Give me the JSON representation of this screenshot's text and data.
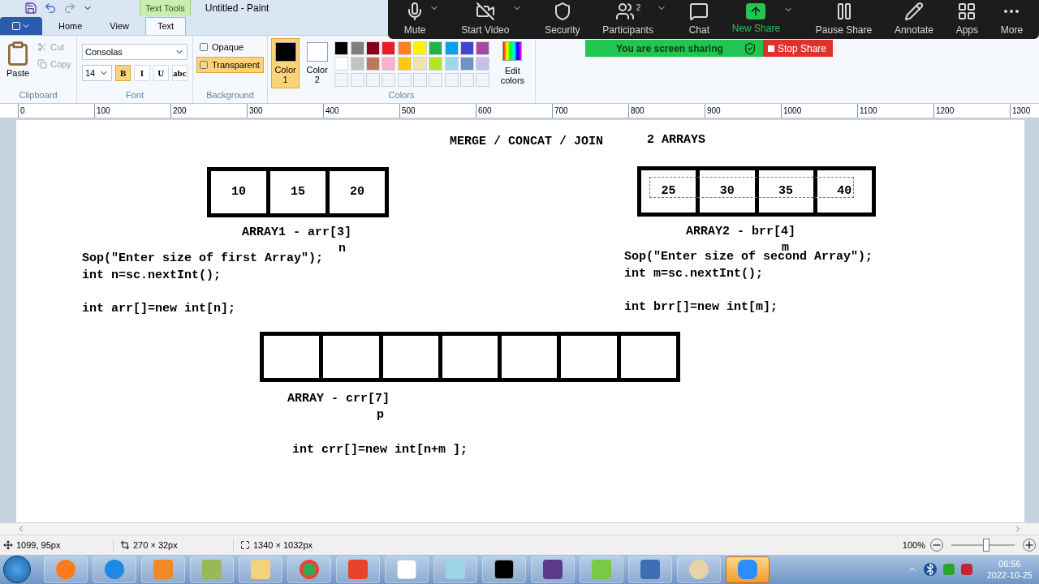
{
  "window": {
    "title": "Untitled - Paint",
    "contextual_tab": "Text Tools"
  },
  "ribbon_tabs": [
    {
      "label": "Home",
      "selected": false
    },
    {
      "label": "View",
      "selected": false
    },
    {
      "label": "Text",
      "selected": true
    }
  ],
  "clipboard": {
    "paste": "Paste",
    "cut": "Cut",
    "copy": "Copy",
    "group": "Clipboard"
  },
  "font": {
    "family": "Consolas",
    "size": "14",
    "group": "Font",
    "styles": [
      {
        "label": "B",
        "selected": true
      },
      {
        "label": "I",
        "selected": false
      },
      {
        "label": "U",
        "selected": false
      },
      {
        "label": "abc",
        "selected": false
      }
    ]
  },
  "background": {
    "group": "Background",
    "options": [
      {
        "label": "Opaque",
        "selected": false
      },
      {
        "label": "Transparent",
        "selected": true
      }
    ]
  },
  "colors": {
    "group": "Colors",
    "edit": "Edit colors",
    "slots": [
      {
        "label": "Color",
        "number": "1",
        "color": "#000000",
        "selected": true
      },
      {
        "label": "Color",
        "number": "2",
        "color": "#ffffff",
        "selected": false
      }
    ],
    "palette": [
      {
        "color": "#000000"
      },
      {
        "color": "#7f7f7f"
      },
      {
        "color": "#880015"
      },
      {
        "color": "#ed1c24"
      },
      {
        "color": "#ff7f27"
      },
      {
        "color": "#fff200"
      },
      {
        "color": "#22b14c"
      },
      {
        "color": "#00a2e8"
      },
      {
        "color": "#3f48cc"
      },
      {
        "color": "#a349a4"
      },
      {
        "color": "#ffffff"
      },
      {
        "color": "#c3c3c3"
      },
      {
        "color": "#b97a57"
      },
      {
        "color": "#ffaec9"
      },
      {
        "color": "#ffc90e"
      },
      {
        "color": "#efe4b0"
      },
      {
        "color": "#b5e61d"
      },
      {
        "color": "#99d9ea"
      },
      {
        "color": "#7092be"
      },
      {
        "color": "#c8bfe7"
      }
    ]
  },
  "ruler": [
    "0",
    "100",
    "200",
    "300",
    "400",
    "500",
    "600",
    "700",
    "800",
    "900",
    "1000",
    "1100",
    "1200",
    "1300"
  ],
  "canvas": {
    "heading": "MERGE / CONCAT / JOIN",
    "heading_2": "2 ARRAYS",
    "arrays": [
      {
        "cells": [
          {
            "kind": "value",
            "text": "10"
          },
          {
            "kind": "value",
            "text": "15"
          },
          {
            "kind": "value",
            "text": "20"
          }
        ],
        "label": "ARRAY1 - arr[3]",
        "size_var": "n",
        "editing": false,
        "input_code": [
          "Sop(\"Enter size of first Array\");",
          "int n=sc.nextInt();"
        ],
        "declaration": "int arr[]=new int[n];"
      },
      {
        "cells": [
          {
            "kind": "value",
            "text": "25"
          },
          {
            "kind": "value",
            "text": "30"
          },
          {
            "kind": "value",
            "text": "35"
          },
          {
            "kind": "value",
            "text": "40"
          }
        ],
        "label": "ARRAY2 - brr[4]",
        "size_var": "m",
        "editing": true,
        "input_code": [
          "Sop(\"Enter size of second Array\");",
          "int m=sc.nextInt();"
        ],
        "declaration": "int brr[]=new int[m];"
      },
      {
        "cells": [
          {
            "kind": "empty"
          },
          {
            "kind": "empty"
          },
          {
            "kind": "empty"
          },
          {
            "kind": "empty"
          },
          {
            "kind": "empty"
          },
          {
            "kind": "empty"
          },
          {
            "kind": "empty"
          }
        ],
        "label": "ARRAY - crr[7]",
        "size_var": "p",
        "editing": false,
        "declaration": "int crr[]=new int[n+m ];"
      }
    ]
  },
  "status_bar": {
    "cursor": "1099, 95px",
    "selection": "270 × 32px",
    "size": "1340 × 1032px",
    "zoom": "100%",
    "zoom_slider": {
      "level": 0.55
    }
  },
  "meeting_toolbar": {
    "buttons": [
      {
        "kind": "mic",
        "label": "Mute",
        "has_menu": true
      },
      {
        "kind": "video",
        "label": "Start Video",
        "has_menu": true
      },
      {
        "kind": "security",
        "label": "Security",
        "has_menu": false
      },
      {
        "kind": "participants",
        "label": "Participants",
        "has_menu": true,
        "badge": "2"
      },
      {
        "kind": "chat",
        "label": "Chat",
        "has_menu": false
      },
      {
        "kind": "share",
        "label": "New Share",
        "has_menu": true
      },
      {
        "kind": "pause",
        "label": "Pause Share",
        "has_menu": false
      },
      {
        "kind": "annotate",
        "label": "Annotate",
        "has_menu": false
      },
      {
        "kind": "apps",
        "label": "Apps",
        "has_menu": false
      },
      {
        "kind": "more",
        "label": "More",
        "has_menu": false
      }
    ],
    "sharing_banner": "You are screen sharing",
    "stop_button": "Stop Share"
  },
  "taskbar": {
    "apps": [
      {
        "selected": false
      },
      {
        "selected": false
      },
      {
        "selected": false
      },
      {
        "selected": false
      },
      {
        "selected": false
      },
      {
        "selected": false
      },
      {
        "selected": false
      },
      {
        "selected": false
      },
      {
        "selected": false
      },
      {
        "selected": false
      },
      {
        "selected": false
      },
      {
        "selected": false
      },
      {
        "selected": false
      },
      {
        "selected": false
      },
      {
        "selected": true
      }
    ],
    "clock_time": "06:56",
    "clock_date": "2022-10-25"
  }
}
